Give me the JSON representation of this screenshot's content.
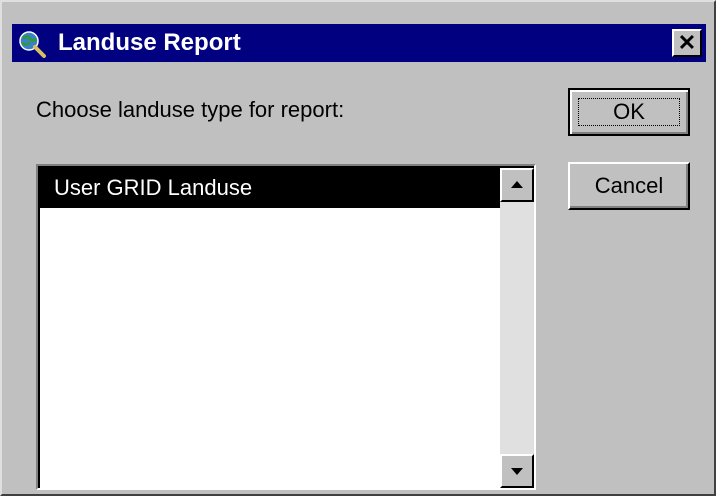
{
  "window": {
    "title": "Landuse Report",
    "close_symbol": "✕",
    "icon": "globe-magnifier-icon"
  },
  "dialog": {
    "prompt": "Choose landuse type for report:",
    "ok_label": "OK",
    "cancel_label": "Cancel"
  },
  "landuse_list": {
    "items": [
      {
        "label": "User GRID Landuse",
        "selected": true
      }
    ]
  },
  "colors": {
    "titlebar": "#000080",
    "window_face": "#c0c0c0",
    "selection": "#000000"
  }
}
